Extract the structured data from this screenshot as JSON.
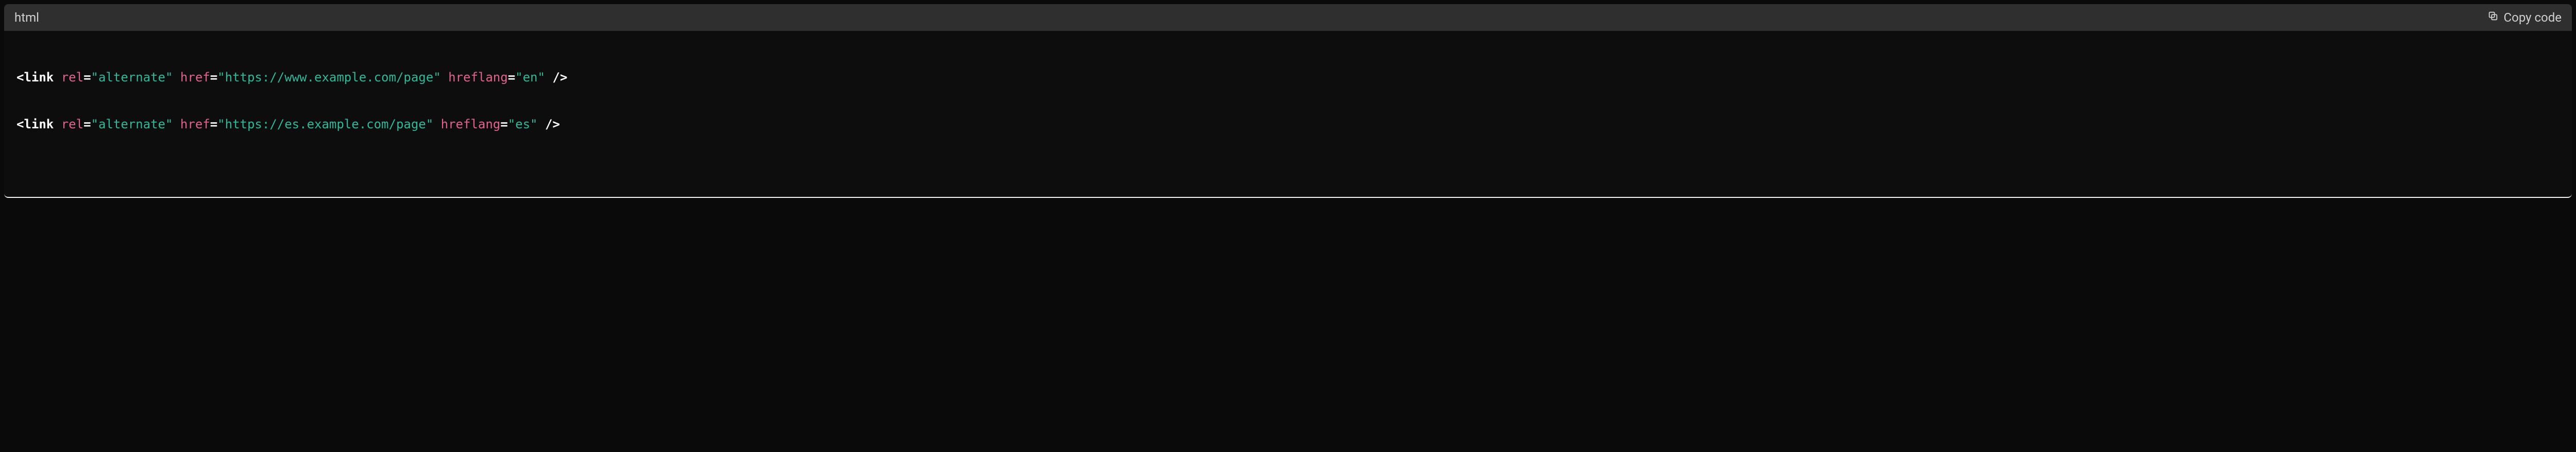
{
  "header": {
    "language_label": "html",
    "copy_label": "Copy code"
  },
  "code": {
    "lines": [
      {
        "tag": "link",
        "attrs": [
          {
            "name": "rel",
            "value": "\"alternate\""
          },
          {
            "name": "href",
            "value": "\"https://www.example.com/page\""
          },
          {
            "name": "hreflang",
            "value": "\"en\""
          }
        ]
      },
      {
        "tag": "link",
        "attrs": [
          {
            "name": "rel",
            "value": "\"alternate\""
          },
          {
            "name": "href",
            "value": "\"https://es.example.com/page\""
          },
          {
            "name": "hreflang",
            "value": "\"es\""
          }
        ]
      }
    ]
  }
}
